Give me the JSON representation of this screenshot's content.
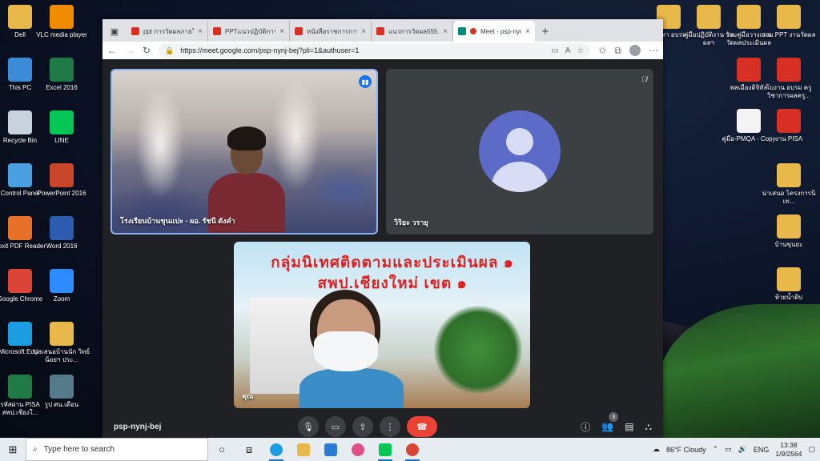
{
  "desktop": {
    "left_icons": [
      {
        "label": "Dell",
        "glyph": "folder-icon",
        "color": "#e8b84a"
      },
      {
        "label": "VLC media player",
        "glyph": "vlc-icon",
        "color": "#f08c00"
      },
      {
        "label": "This PC",
        "glyph": "computer-icon",
        "color": "#3b8bd8"
      },
      {
        "label": "Excel 2016",
        "glyph": "excel-icon",
        "color": "#1f7a45"
      },
      {
        "label": "Recycle Bin",
        "glyph": "recycle-bin-icon",
        "color": "#c8d2dc"
      },
      {
        "label": "LINE",
        "glyph": "line-icon",
        "color": "#06c755"
      },
      {
        "label": "Control Panel",
        "glyph": "control-panel-icon",
        "color": "#4aa0e0"
      },
      {
        "label": "PowerPoint 2016",
        "glyph": "powerpoint-icon",
        "color": "#c8462a"
      },
      {
        "label": "Foxit PDF Reader",
        "glyph": "foxit-icon",
        "color": "#e8712a"
      },
      {
        "label": "Word 2016",
        "glyph": "word-icon",
        "color": "#2b5caf"
      },
      {
        "label": "Google Chrome",
        "glyph": "chrome-icon",
        "color": "#db4437"
      },
      {
        "label": "Zoom",
        "glyph": "zoom-icon",
        "color": "#2d8cff"
      },
      {
        "label": "Microsoft Edge",
        "glyph": "edge-icon",
        "color": "#1b9de2"
      },
      {
        "label": "น่าเสนอบ้านนัก วิทย์น้อยฯ ประ...",
        "glyph": "folder-icon",
        "color": "#e8b84a"
      },
      {
        "label": "รหัสผ่าน PISA สพป.เชียงใ...",
        "glyph": "excel-icon",
        "color": "#1f7a45"
      },
      {
        "label": "รูป ศน.เตือน",
        "glyph": "photo-icon",
        "color": "#557a8a"
      }
    ],
    "right_icons": [
      {
        "label": "เนื้อหา อบรม",
        "glyph": "folder-icon",
        "color": "#e8b84a"
      },
      {
        "label": "คู่มือปฏิบัติงาน วัดผลฯ",
        "glyph": "folder-icon",
        "color": "#e8b84a"
      },
      {
        "label": "รวมคู่มือวางแผน วัดผลประเมินผล",
        "glyph": "folder-icon",
        "color": "#e8b84a"
      },
      {
        "label": "รวม PPT งานวัดผล",
        "glyph": "folder-icon",
        "color": "#e8b84a"
      },
      {
        "label": "พลเมืองดิจิทัล",
        "glyph": "pdf-icon",
        "color": "#d93025"
      },
      {
        "label": "โบงาน อบรม ครู วิชาการผลครู...",
        "glyph": "pdf-icon",
        "color": "#d93025"
      },
      {
        "label": "คู่มือ-PMQA - Copy",
        "glyph": "document-icon",
        "color": "#f4f4f4"
      },
      {
        "label": "งาน PISA",
        "glyph": "pdf-icon",
        "color": "#d93025"
      },
      {
        "label": "น่าเสนอ โครงการนิเท...",
        "glyph": "folder-icon",
        "color": "#e8b84a"
      },
      {
        "label": "บ้านขุนยะ",
        "glyph": "folder-icon",
        "color": "#e8b84a"
      },
      {
        "label": "ห้วยน้ำดิบ",
        "glyph": "folder-icon",
        "color": "#e8b84a"
      }
    ]
  },
  "browser": {
    "tabs": [
      {
        "label": "ppt การวัดผลภายใน",
        "active": false
      },
      {
        "label": "PPTแนวปฏิบัติการวัด",
        "active": false
      },
      {
        "label": "หนังสือราชการการวัด",
        "active": false
      },
      {
        "label": "แนวการวัดผล555.p",
        "active": false
      },
      {
        "label": "Meet - psp-nynj-bej",
        "active": true
      }
    ],
    "url": "https://meet.google.com/psp-nynj-bej?pli=1&authuser=1"
  },
  "meet": {
    "participants": [
      {
        "name": "โรงเรียนบ้านขุนแปะ - ผอ. รัชนี ตังคำ",
        "speaking": true
      },
      {
        "name": "วิริยะ วรายุ",
        "muted": true
      },
      {
        "name": "คุณ"
      }
    ],
    "banner_text": "กลุ่มนิเทศติดตามและประเมินผล ๑ สพป.เชียงใหม่ เขต ๑",
    "meeting_code": "psp-nynj-bej",
    "people_count": "3"
  },
  "taskbar": {
    "search_placeholder": "Type here to search",
    "weather": "86°F Cloudy",
    "language": "ENG",
    "time": "13:38",
    "date": "1/9/2564"
  }
}
